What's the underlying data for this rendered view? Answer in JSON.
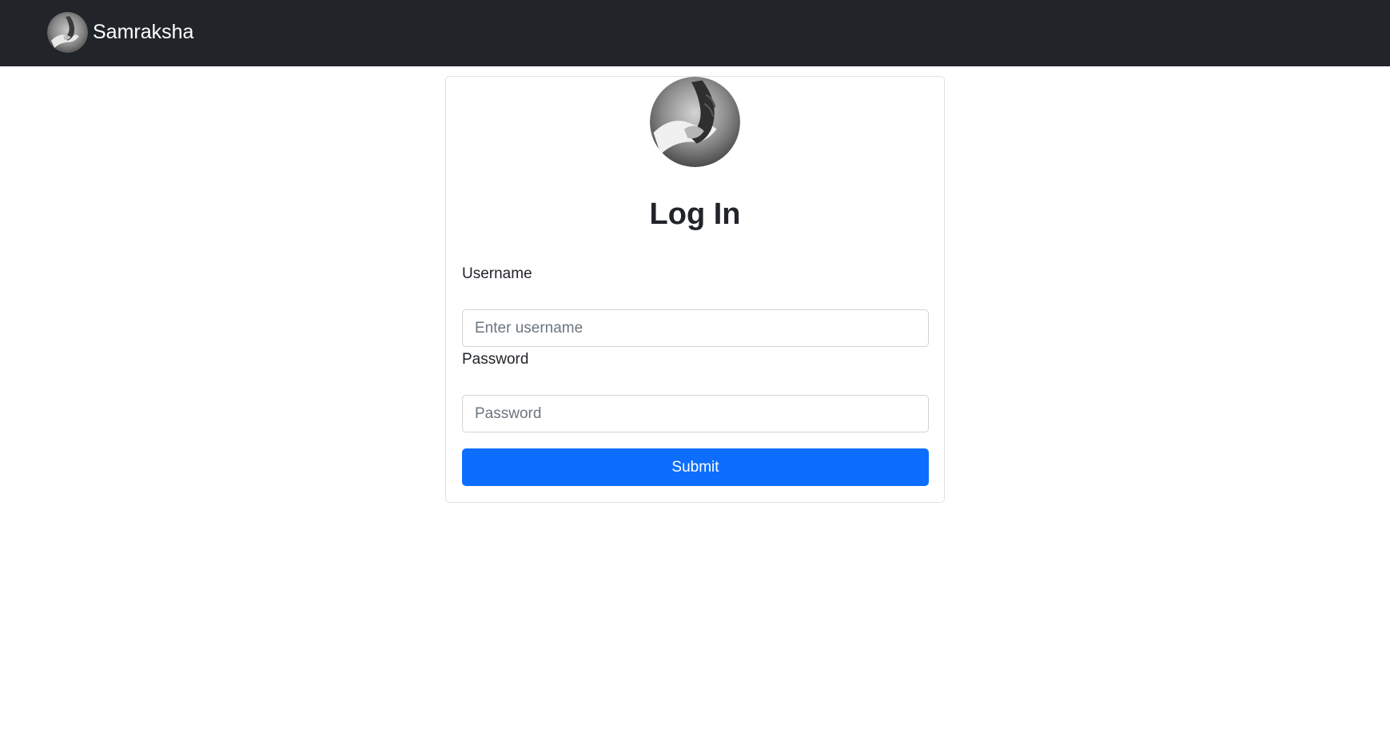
{
  "navbar": {
    "brand_name": "Samraksha",
    "logo_icon": "holding-hands-photo"
  },
  "login": {
    "avatar_icon": "holding-hands-photo",
    "title": "Log In",
    "username_label": "Username",
    "username_placeholder": "Enter username",
    "username_value": "",
    "password_label": "Password",
    "password_placeholder": "Password",
    "password_value": "",
    "submit_label": "Submit"
  },
  "colors": {
    "navbar_bg": "#212529",
    "primary": "#0d6efd",
    "border": "#dee2e6",
    "input_border": "#ced4da",
    "placeholder": "#6c757d"
  }
}
